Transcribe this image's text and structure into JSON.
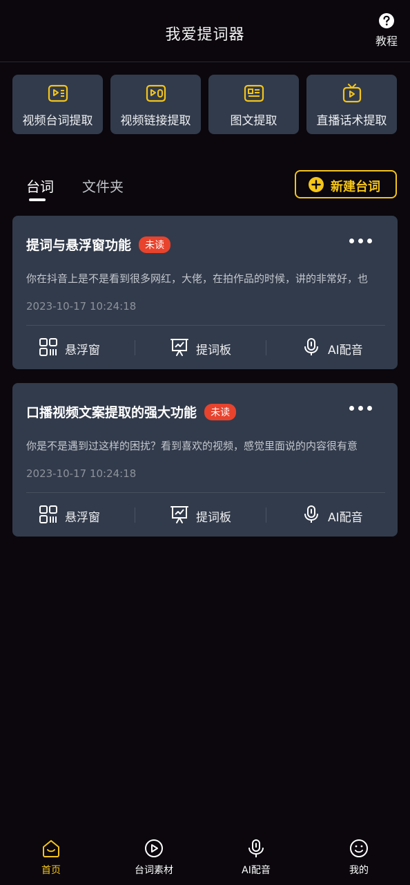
{
  "header": {
    "title": "我爱提词器",
    "help_label": "教程",
    "help_icon": "question-circle-icon"
  },
  "tools": [
    {
      "label": "视频台词提取",
      "icon": "video-subtitle-icon"
    },
    {
      "label": "视频链接提取",
      "icon": "video-link-icon"
    },
    {
      "label": "图文提取",
      "icon": "image-text-icon"
    },
    {
      "label": "直播话术提取",
      "icon": "tv-play-icon"
    }
  ],
  "tabs": {
    "active": "台词",
    "inactive": "文件夹"
  },
  "new_button": {
    "label": "新建台词",
    "icon": "plus-circle-icon"
  },
  "cards": [
    {
      "title": "提词与悬浮窗功能",
      "badge": "未读",
      "excerpt": "你在抖音上是不是看到很多网红，大佬，在拍作品的时候，讲的非常好，也",
      "time": "2023-10-17 10:24:18",
      "actions": [
        "悬浮窗",
        "提词板",
        "AI配音"
      ]
    },
    {
      "title": "口播视频文案提取的强大功能",
      "badge": "未读",
      "excerpt": "你是不是遇到过这样的困扰？看到喜欢的视频，感觉里面说的内容很有意",
      "time": "2023-10-17 10:24:18",
      "actions": [
        "悬浮窗",
        "提词板",
        "AI配音"
      ]
    }
  ],
  "bottom_nav": [
    {
      "label": "首页",
      "icon": "home-icon",
      "active": true
    },
    {
      "label": "台词素材",
      "icon": "play-circle-icon",
      "active": false
    },
    {
      "label": "AI配音",
      "icon": "microphone-icon",
      "active": false
    },
    {
      "label": "我的",
      "icon": "smile-icon",
      "active": false
    }
  ],
  "colors": {
    "background": "#0b070d",
    "card": "#323b4b",
    "accent": "#f5c518",
    "badge": "#e8432d"
  }
}
